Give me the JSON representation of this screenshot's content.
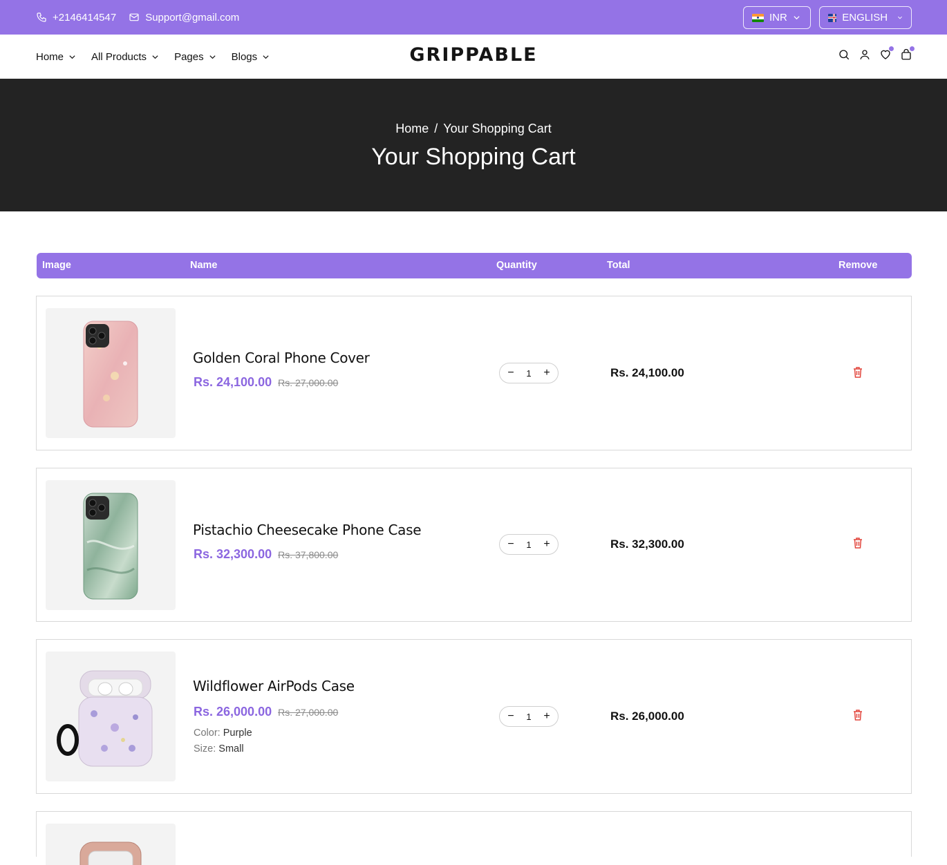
{
  "topbar": {
    "phone": "+2146414547",
    "email": "Support@gmail.com",
    "currency": "INR",
    "language": "ENGLISH"
  },
  "nav": {
    "menu": [
      {
        "label": "Home"
      },
      {
        "label": "All Products"
      },
      {
        "label": "Pages"
      },
      {
        "label": "Blogs"
      }
    ],
    "logo": "GRIPPABLE",
    "icons": [
      "search-icon",
      "user-icon",
      "heart-icon",
      "bag-icon"
    ]
  },
  "hero": {
    "breadcrumb_home": "Home",
    "breadcrumb_sep": "/",
    "breadcrumb_current": "Your Shopping Cart",
    "title": "Your Shopping Cart"
  },
  "table": {
    "headers": {
      "image": "Image",
      "name": "Name",
      "quantity": "Quantity",
      "total": "Total",
      "remove": "Remove"
    }
  },
  "cart": [
    {
      "name": "Golden Coral Phone Cover",
      "price": "Rs. 24,100.00",
      "old_price": "Rs. 27,000.00",
      "qty": "1",
      "total": "Rs. 24,100.00"
    },
    {
      "name": "Pistachio Cheesecake Phone Case",
      "price": "Rs. 32,300.00",
      "old_price": "Rs. 37,800.00",
      "qty": "1",
      "total": "Rs. 32,300.00"
    },
    {
      "name": "Wildflower AirPods Case",
      "price": "Rs. 26,000.00",
      "old_price": "Rs. 27,000.00",
      "color_label": "Color:",
      "color": "Purple",
      "size_label": "Size:",
      "size": "Small",
      "qty": "1",
      "total": "Rs. 26,000.00"
    }
  ],
  "colors": {
    "accent": "#9473e6",
    "hero_bg": "#232323",
    "trash": "#e2453c"
  },
  "qty_controls": {
    "minus": "−",
    "plus": "+"
  }
}
